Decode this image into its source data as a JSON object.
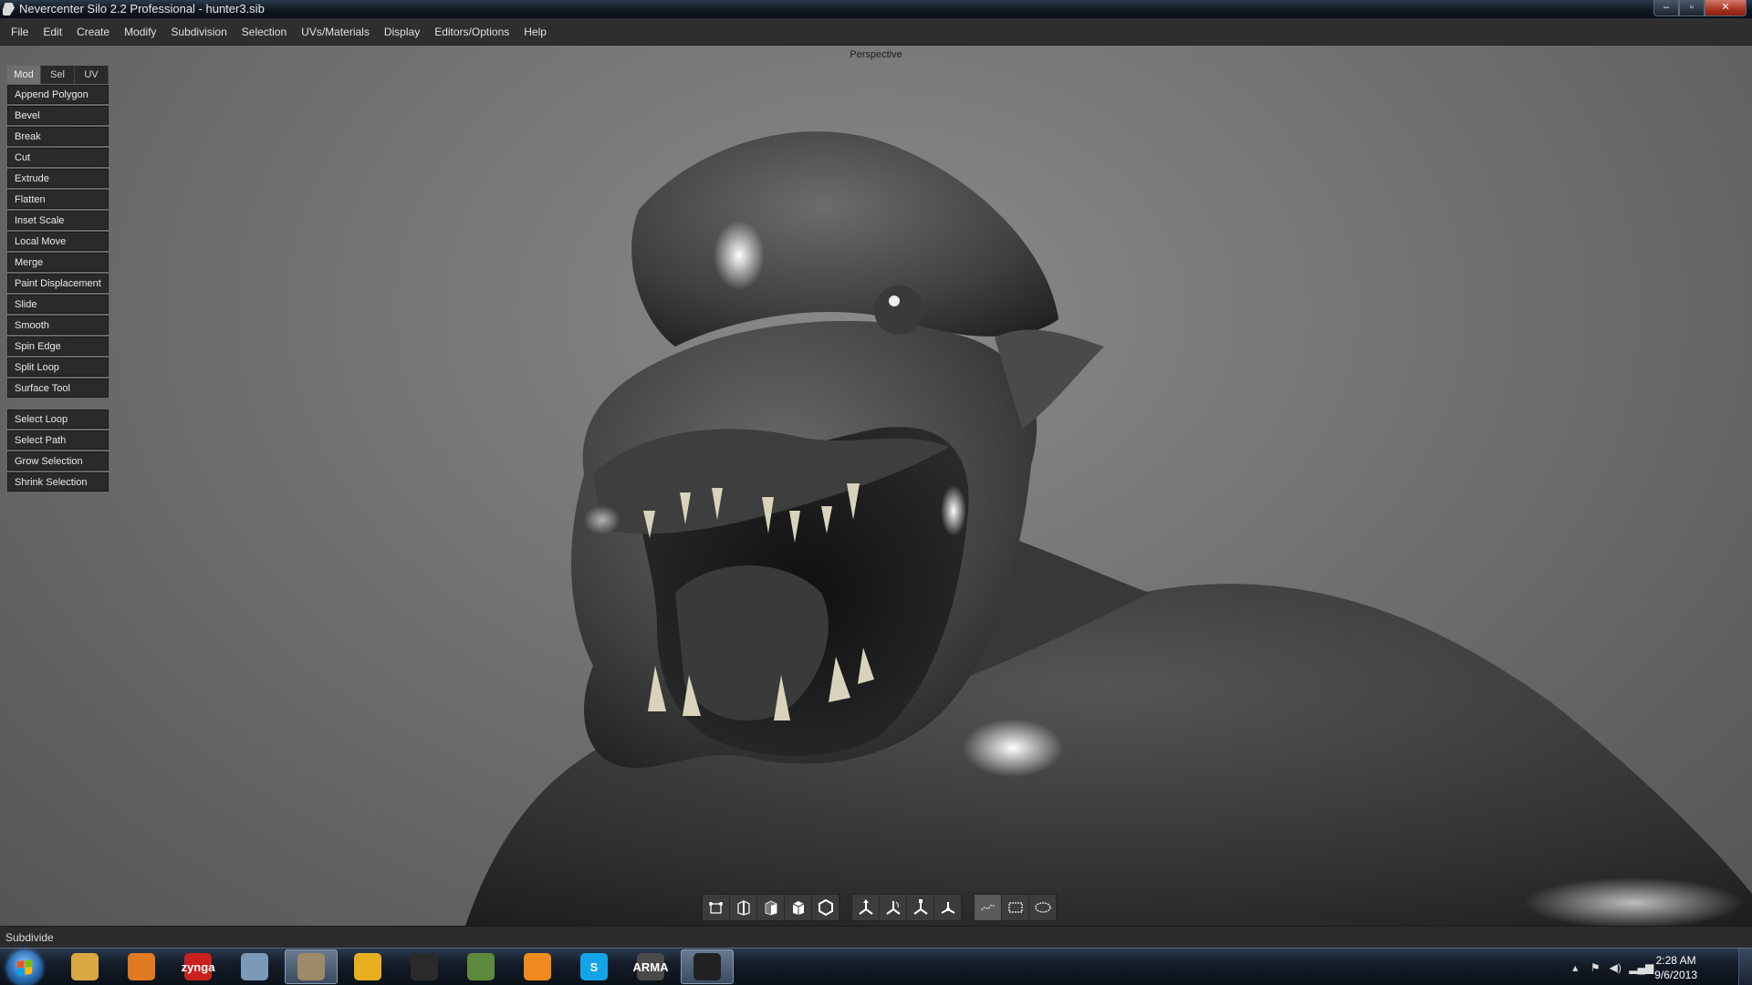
{
  "window": {
    "title": "Nevercenter Silo 2.2 Professional - hunter3.sib",
    "minimize": "–",
    "maximize": "▫",
    "close": "✕"
  },
  "menu": [
    "File",
    "Edit",
    "Create",
    "Modify",
    "Subdivision",
    "Selection",
    "UVs/Materials",
    "Display",
    "Editors/Options",
    "Help"
  ],
  "viewport": {
    "label": "Perspective"
  },
  "tool_panel": {
    "tabs": [
      {
        "label": "Mod",
        "active": true
      },
      {
        "label": "Sel",
        "active": false
      },
      {
        "label": "UV",
        "active": false
      }
    ],
    "tools": [
      "Append Polygon",
      "Bevel",
      "Break",
      "Cut",
      "Extrude",
      "Flatten",
      "Inset Scale",
      "Local Move",
      "Merge",
      "Paint Displacement",
      "Slide",
      "Smooth",
      "Spin Edge",
      "Split Loop",
      "Surface Tool"
    ],
    "selection_tools": [
      "Select Loop",
      "Select Path",
      "Grow Selection",
      "Shrink Selection"
    ]
  },
  "bottom_toolbar": {
    "groups": [
      [
        "vertex-mode-icon",
        "edge-mode-icon",
        "face-mode-icon",
        "object-mode-icon",
        "hexagon-mode-icon"
      ],
      [
        "move-manipulator-icon",
        "rotate-manipulator-icon",
        "scale-manipulator-icon",
        "universal-manipulator-icon"
      ],
      [
        "paint-select-icon",
        "rectangle-select-icon",
        "lasso-select-icon"
      ]
    ]
  },
  "status": {
    "text": "Subdivide"
  },
  "taskbar": {
    "apps": [
      {
        "name": "explorer-icon",
        "label": "",
        "color": "#d9a840",
        "active": false
      },
      {
        "name": "media-player-icon",
        "label": "",
        "color": "#e07a20",
        "active": false
      },
      {
        "name": "zynga-icon",
        "label": "zynga",
        "color": "#c8201e",
        "active": false
      },
      {
        "name": "calculator-icon",
        "label": "",
        "color": "#7a9ab8",
        "active": false
      },
      {
        "name": "steam-icon",
        "label": "",
        "color": "#9c8a68",
        "active": true
      },
      {
        "name": "chrome-icon",
        "label": "",
        "color": "#e8b020",
        "active": false
      },
      {
        "name": "horse-app-icon",
        "label": "",
        "color": "#2a2a2a",
        "active": false
      },
      {
        "name": "minecraft-icon",
        "label": "",
        "color": "#5c8a3c",
        "active": false
      },
      {
        "name": "orange-app-icon",
        "label": "",
        "color": "#f08a20",
        "active": false
      },
      {
        "name": "skype-icon",
        "label": "S",
        "color": "#12a5e8",
        "active": false
      },
      {
        "name": "arma-icon",
        "label": "ARMA",
        "color": "#4a4a4a",
        "active": false
      },
      {
        "name": "silo-icon",
        "label": "",
        "color": "#222222",
        "active": true
      }
    ],
    "clock_time": "2:28 AM",
    "clock_date": "9/6/2013"
  }
}
